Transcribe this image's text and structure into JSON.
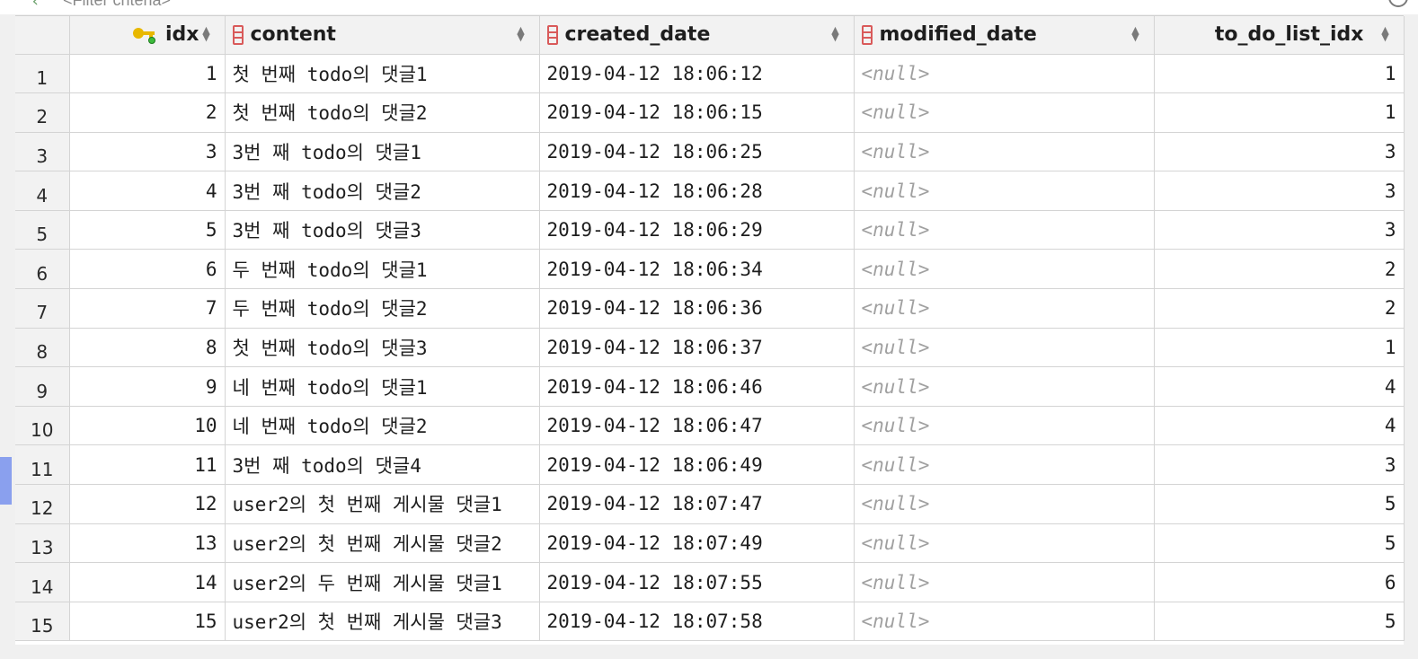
{
  "filter": {
    "placeholder": "<Filter criteria>"
  },
  "columns": [
    {
      "key": "idx",
      "label": "idx",
      "icon": "primary-key-icon",
      "align": "left"
    },
    {
      "key": "content",
      "label": "content",
      "icon": "column-icon",
      "align": "left"
    },
    {
      "key": "created_date",
      "label": "created_date",
      "icon": "column-icon",
      "align": "left"
    },
    {
      "key": "modified_date",
      "label": "modified_date",
      "icon": "column-icon",
      "align": "left"
    },
    {
      "key": "to_do_list_idx",
      "label": "to_do_list_idx",
      "icon": "",
      "align": "right"
    }
  ],
  "null_label": "<null>",
  "rows": [
    {
      "row": "1",
      "idx": "1",
      "content": "첫 번째 todo의 댓글1",
      "created_date": "2019-04-12 18:06:12",
      "modified_date": null,
      "to_do_list_idx": "1"
    },
    {
      "row": "2",
      "idx": "2",
      "content": "첫 번째 todo의 댓글2",
      "created_date": "2019-04-12 18:06:15",
      "modified_date": null,
      "to_do_list_idx": "1"
    },
    {
      "row": "3",
      "idx": "3",
      "content": "3번 째 todo의 댓글1",
      "created_date": "2019-04-12 18:06:25",
      "modified_date": null,
      "to_do_list_idx": "3"
    },
    {
      "row": "4",
      "idx": "4",
      "content": "3번 째 todo의 댓글2",
      "created_date": "2019-04-12 18:06:28",
      "modified_date": null,
      "to_do_list_idx": "3"
    },
    {
      "row": "5",
      "idx": "5",
      "content": "3번 째 todo의 댓글3",
      "created_date": "2019-04-12 18:06:29",
      "modified_date": null,
      "to_do_list_idx": "3"
    },
    {
      "row": "6",
      "idx": "6",
      "content": "두 번째 todo의 댓글1",
      "created_date": "2019-04-12 18:06:34",
      "modified_date": null,
      "to_do_list_idx": "2"
    },
    {
      "row": "7",
      "idx": "7",
      "content": "두 번째 todo의 댓글2",
      "created_date": "2019-04-12 18:06:36",
      "modified_date": null,
      "to_do_list_idx": "2"
    },
    {
      "row": "8",
      "idx": "8",
      "content": "첫 번째 todo의 댓글3",
      "created_date": "2019-04-12 18:06:37",
      "modified_date": null,
      "to_do_list_idx": "1"
    },
    {
      "row": "9",
      "idx": "9",
      "content": "네 번째 todo의 댓글1",
      "created_date": "2019-04-12 18:06:46",
      "modified_date": null,
      "to_do_list_idx": "4"
    },
    {
      "row": "10",
      "idx": "10",
      "content": "네 번째 todo의 댓글2",
      "created_date": "2019-04-12 18:06:47",
      "modified_date": null,
      "to_do_list_idx": "4"
    },
    {
      "row": "11",
      "idx": "11",
      "content": "3번 째 todo의 댓글4",
      "created_date": "2019-04-12 18:06:49",
      "modified_date": null,
      "to_do_list_idx": "3"
    },
    {
      "row": "12",
      "idx": "12",
      "content": "user2의 첫 번째 게시물 댓글1",
      "created_date": "2019-04-12 18:07:47",
      "modified_date": null,
      "to_do_list_idx": "5"
    },
    {
      "row": "13",
      "idx": "13",
      "content": "user2의 첫 번째 게시물 댓글2",
      "created_date": "2019-04-12 18:07:49",
      "modified_date": null,
      "to_do_list_idx": "5"
    },
    {
      "row": "14",
      "idx": "14",
      "content": "user2의 두 번째 게시물 댓글1",
      "created_date": "2019-04-12 18:07:55",
      "modified_date": null,
      "to_do_list_idx": "6"
    },
    {
      "row": "15",
      "idx": "15",
      "content": "user2의 첫 번째 게시물 댓글3",
      "created_date": "2019-04-12 18:07:58",
      "modified_date": null,
      "to_do_list_idx": "5"
    }
  ]
}
